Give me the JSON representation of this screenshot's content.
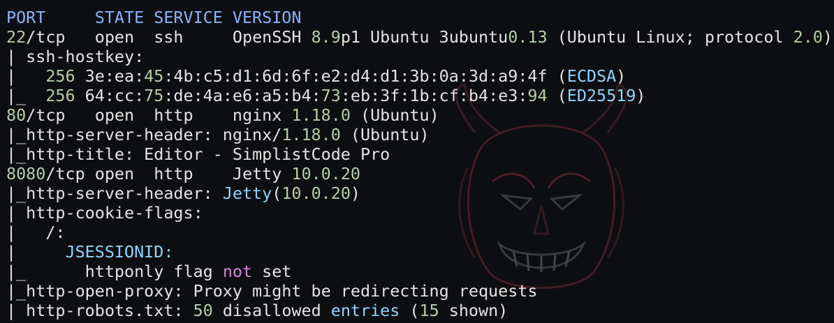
{
  "window": {
    "wallpaper_icon": "demon-mask-icon"
  },
  "colors": {
    "background": "#0d0e11",
    "text": "#e4e4e4",
    "header": "#8ab4ff",
    "number": "#b5cea8",
    "keyword": "#8fd4ff",
    "negation": "#d284d8"
  },
  "output": [
    [
      {
        "t": "PORT     STATE SERVICE VERSION",
        "c": "head"
      }
    ],
    [
      {
        "t": "22",
        "c": "num"
      },
      {
        "t": "/tcp   open  ssh     OpenSSH "
      },
      {
        "t": "8.9",
        "c": "num"
      },
      {
        "t": "p1 Ubuntu 3ubuntu"
      },
      {
        "t": "0.13",
        "c": "num"
      },
      {
        "t": " (Ubuntu Linux; protocol "
      },
      {
        "t": "2.0",
        "c": "num"
      },
      {
        "t": ")"
      }
    ],
    [
      {
        "t": "| ssh-hostkey:"
      }
    ],
    [
      {
        "t": "|   "
      },
      {
        "t": "256",
        "c": "num"
      },
      {
        "t": " 3e:ea:"
      },
      {
        "t": "45",
        "c": "num"
      },
      {
        "t": ":4b:c5:d1:6d:6f:e2:d4:d1:3b:0a:3d:a9:4f ("
      },
      {
        "t": "ECDSA",
        "c": "kw"
      },
      {
        "t": ")"
      }
    ],
    [
      {
        "t": "|_  "
      },
      {
        "t": "256",
        "c": "num"
      },
      {
        "t": " 64:cc:"
      },
      {
        "t": "75",
        "c": "num"
      },
      {
        "t": ":de:4a:e6:a5:b4:"
      },
      {
        "t": "73",
        "c": "num"
      },
      {
        "t": ":eb:3f:1b:cf:b4:e3:"
      },
      {
        "t": "94",
        "c": "num"
      },
      {
        "t": " ("
      },
      {
        "t": "ED25519",
        "c": "kw"
      },
      {
        "t": ")"
      }
    ],
    [
      {
        "t": "80",
        "c": "num"
      },
      {
        "t": "/tcp   open  http    nginx "
      },
      {
        "t": "1.18.0",
        "c": "num"
      },
      {
        "t": " (Ubuntu)"
      }
    ],
    [
      {
        "t": "|_http-server-header: nginx/"
      },
      {
        "t": "1.18.0",
        "c": "num"
      },
      {
        "t": " (Ubuntu)"
      }
    ],
    [
      {
        "t": "|_http-title: Editor - SimplistCode Pro"
      }
    ],
    [
      {
        "t": "8080",
        "c": "num"
      },
      {
        "t": "/tcp open  http    Jetty "
      },
      {
        "t": "10.0.20",
        "c": "num"
      }
    ],
    [
      {
        "t": "|_http-server-header: "
      },
      {
        "t": "Jetty",
        "c": "kw"
      },
      {
        "t": "("
      },
      {
        "t": "10.0.20",
        "c": "num"
      },
      {
        "t": ")"
      }
    ],
    [
      {
        "t": "| http-cookie-flags:"
      }
    ],
    [
      {
        "t": "|   /:"
      }
    ],
    [
      {
        "t": "|     "
      },
      {
        "t": "JSESSIONID:",
        "c": "kw"
      }
    ],
    [
      {
        "t": "|_      httponly flag "
      },
      {
        "t": "not",
        "c": "not"
      },
      {
        "t": " set"
      }
    ],
    [
      {
        "t": "|_http-open-proxy: Proxy might be redirecting requests"
      }
    ],
    [
      {
        "t": "| http-robots.txt: "
      },
      {
        "t": "50",
        "c": "num"
      },
      {
        "t": " disallowed "
      },
      {
        "t": "entries",
        "c": "kw"
      },
      {
        "t": " ("
      },
      {
        "t": "15",
        "c": "num"
      },
      {
        "t": " shown)"
      }
    ]
  ]
}
